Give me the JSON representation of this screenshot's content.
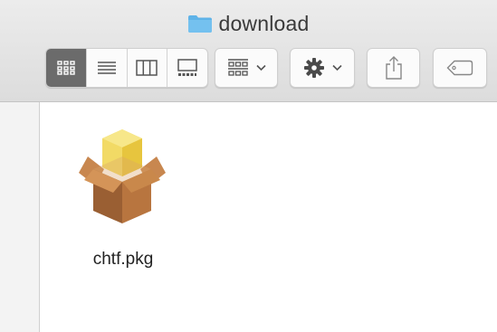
{
  "window": {
    "title": "download",
    "folder_icon": "folder-icon",
    "folder_color": "#5fb3e8"
  },
  "toolbar": {
    "view_modes": [
      {
        "name": "icon-view",
        "icon": "icon-grid-icon",
        "active": true
      },
      {
        "name": "list-view",
        "icon": "list-icon",
        "active": false
      },
      {
        "name": "column-view",
        "icon": "columns-icon",
        "active": false
      },
      {
        "name": "gallery-view",
        "icon": "gallery-icon",
        "active": false
      }
    ],
    "arrange_icon": "group-arrange-icon",
    "action_icon": "gear-icon",
    "share_icon": "share-icon",
    "tag_icon": "tag-icon",
    "active_color": "#6b6b6b"
  },
  "files": [
    {
      "name": "chtf.pkg",
      "icon": "package-icon"
    }
  ]
}
